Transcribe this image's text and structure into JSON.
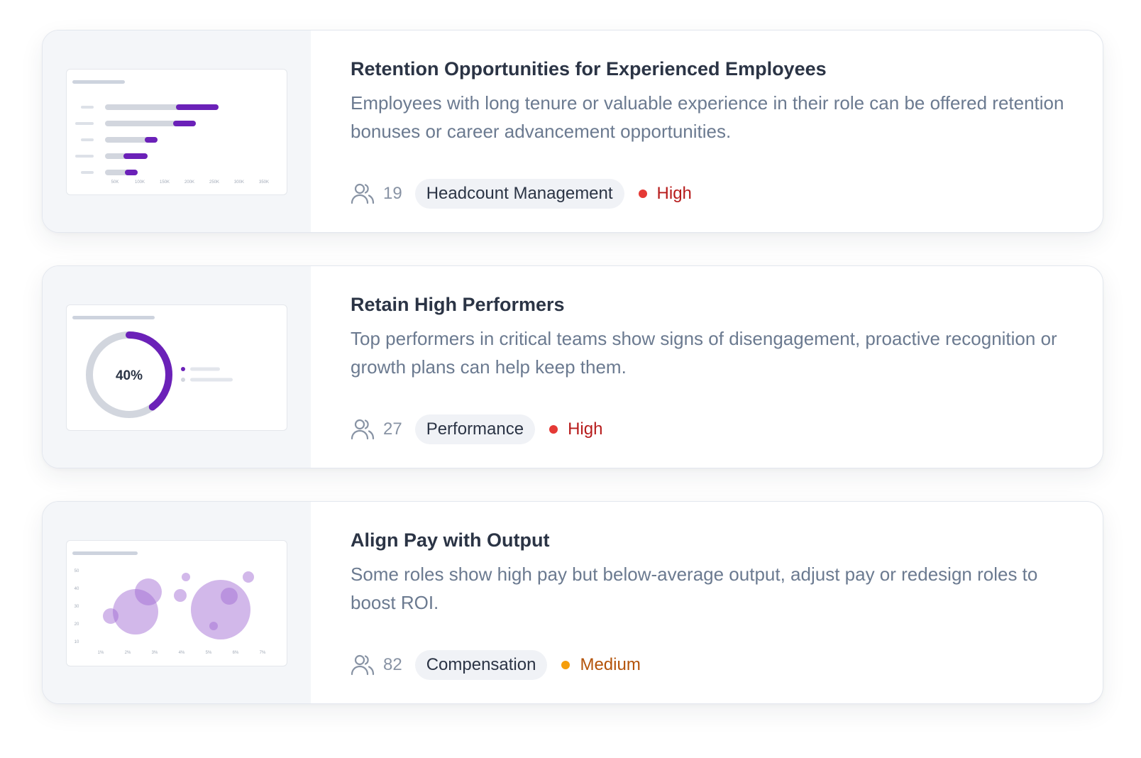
{
  "colors": {
    "accent": "#6b21b8",
    "high_dot": "#e53935",
    "high_text": "#b71c1c",
    "medium_dot": "#f59e0b",
    "medium_text": "#b45309"
  },
  "cards": [
    {
      "title": "Retention Opportunities for Experienced Employees",
      "description": "Employees with long tenure or valuable experience in their role can be offered retention bonuses or career advancement opportunities.",
      "people_icon": "people-icon",
      "count": "19",
      "tag": "Headcount Management",
      "priority": "High",
      "priority_level": "high",
      "thumbnail": {
        "type": "bar",
        "x_ticks": [
          "50K",
          "100K",
          "150K",
          "200K",
          "250K",
          "300K",
          "350K"
        ]
      }
    },
    {
      "title": "Retain High Performers",
      "description": "Top performers in critical teams show signs of disengagement, proactive recognition or growth plans can help keep them.",
      "people_icon": "people-icon",
      "count": "27",
      "tag": "Performance",
      "priority": "High",
      "priority_level": "high",
      "thumbnail": {
        "type": "donut",
        "value_label": "40%",
        "value": 40
      }
    },
    {
      "title": "Align Pay with Output",
      "description": "Some roles show high pay but below-average output, adjust pay or redesign roles to boost ROI.",
      "people_icon": "people-icon",
      "count": "82",
      "tag": "Compensation",
      "priority": "Medium",
      "priority_level": "medium",
      "thumbnail": {
        "type": "bubble",
        "y_ticks": [
          "50",
          "40",
          "30",
          "20",
          "10"
        ],
        "x_ticks": [
          "1%",
          "2%",
          "3%",
          "4%",
          "5%",
          "6%",
          "7%"
        ]
      }
    }
  ]
}
